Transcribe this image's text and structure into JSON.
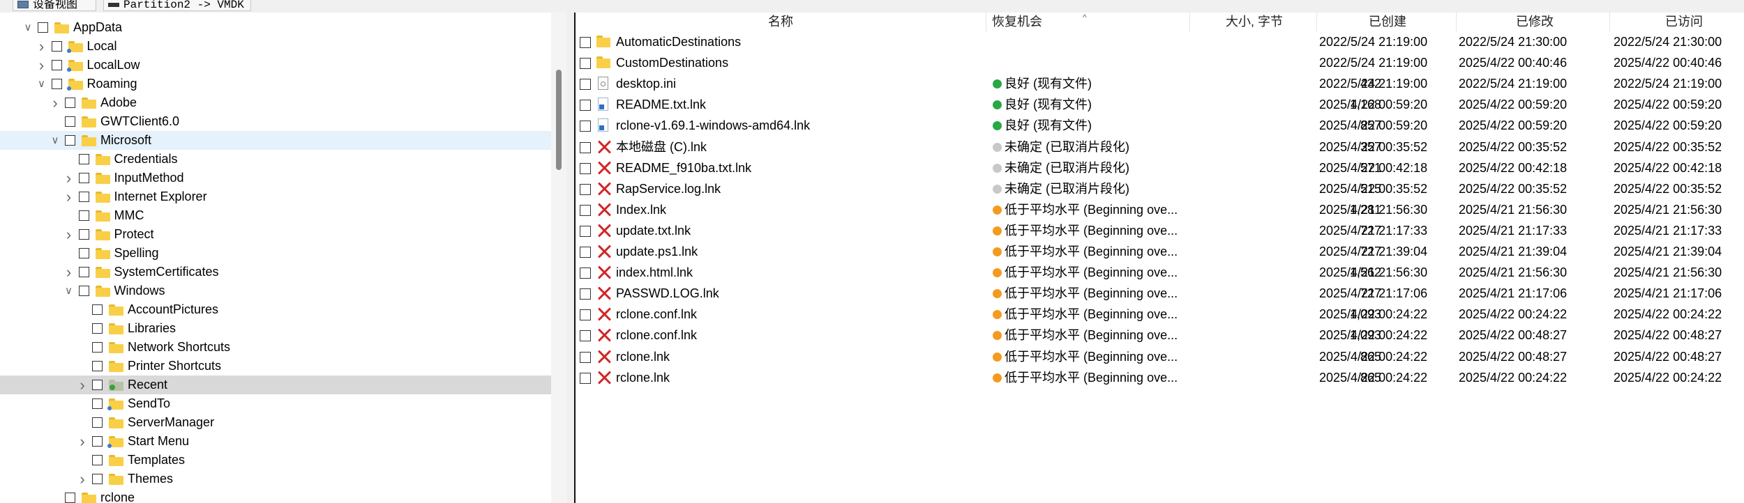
{
  "tabs": [
    {
      "label": "设备视图"
    },
    {
      "label": "Partition2 -> VMDK"
    }
  ],
  "tree": [
    {
      "label": "AppData",
      "indent": 4,
      "expander": "expanded",
      "folder": "yellow",
      "dot": false
    },
    {
      "label": "Local",
      "indent": 5,
      "expander": "collapsed",
      "folder": "yellow",
      "dot": true
    },
    {
      "label": "LocalLow",
      "indent": 5,
      "expander": "collapsed",
      "folder": "yellow",
      "dot": true
    },
    {
      "label": "Roaming",
      "indent": 5,
      "expander": "expanded",
      "folder": "yellow",
      "dot": true
    },
    {
      "label": "Adobe",
      "indent": 6,
      "expander": "collapsed",
      "folder": "yellow",
      "dot": false
    },
    {
      "label": "GWTClient6.0",
      "indent": 6,
      "expander": "none",
      "folder": "yellow",
      "dot": false
    },
    {
      "label": "Microsoft",
      "indent": 6,
      "expander": "expanded",
      "folder": "yellow",
      "dot": false,
      "state": "hover"
    },
    {
      "label": "Credentials",
      "indent": 7,
      "expander": "none",
      "folder": "yellow",
      "dot": false
    },
    {
      "label": "InputMethod",
      "indent": 7,
      "expander": "collapsed",
      "folder": "yellow",
      "dot": false
    },
    {
      "label": "Internet Explorer",
      "indent": 7,
      "expander": "collapsed",
      "folder": "yellow",
      "dot": false
    },
    {
      "label": "MMC",
      "indent": 7,
      "expander": "none",
      "folder": "yellow",
      "dot": false
    },
    {
      "label": "Protect",
      "indent": 7,
      "expander": "collapsed",
      "folder": "yellow",
      "dot": false
    },
    {
      "label": "Spelling",
      "indent": 7,
      "expander": "none",
      "folder": "yellow",
      "dot": false
    },
    {
      "label": "SystemCertificates",
      "indent": 7,
      "expander": "collapsed",
      "folder": "yellow",
      "dot": false
    },
    {
      "label": "Windows",
      "indent": 7,
      "expander": "expanded",
      "folder": "yellow",
      "dot": false
    },
    {
      "label": "AccountPictures",
      "indent": 8,
      "expander": "none",
      "folder": "yellow",
      "dot": false
    },
    {
      "label": "Libraries",
      "indent": 8,
      "expander": "none",
      "folder": "yellow",
      "dot": false
    },
    {
      "label": "Network Shortcuts",
      "indent": 8,
      "expander": "none",
      "folder": "yellow",
      "dot": false
    },
    {
      "label": "Printer Shortcuts",
      "indent": 8,
      "expander": "none",
      "folder": "yellow",
      "dot": false
    },
    {
      "label": "Recent",
      "indent": 8,
      "expander": "collapsed",
      "folder": "gray",
      "dot": false,
      "green": true,
      "state": "selected"
    },
    {
      "label": "SendTo",
      "indent": 8,
      "expander": "none",
      "folder": "yellow",
      "dot": true
    },
    {
      "label": "ServerManager",
      "indent": 8,
      "expander": "none",
      "folder": "yellow",
      "dot": false
    },
    {
      "label": "Start Menu",
      "indent": 8,
      "expander": "collapsed",
      "folder": "yellow",
      "dot": true
    },
    {
      "label": "Templates",
      "indent": 8,
      "expander": "none",
      "folder": "yellow",
      "dot": false
    },
    {
      "label": "Themes",
      "indent": 8,
      "expander": "collapsed",
      "folder": "yellow",
      "dot": false
    },
    {
      "label": "rclone",
      "indent": 6,
      "expander": "none",
      "folder": "yellow",
      "dot": false
    }
  ],
  "list": {
    "columns": {
      "name": "名称",
      "recovery": "恢复机会",
      "size": "大小, 字节",
      "created": "已创建",
      "modified": "已修改",
      "accessed": "已访问"
    },
    "sort_indicator": "^",
    "status_colors": {
      "good": "#27a844",
      "uncertain": "#c8c8c8",
      "below": "#f59a1f"
    },
    "rows": [
      {
        "icon": "folder",
        "name": "AutomaticDestinations",
        "status": "",
        "status_kind": "",
        "size": "",
        "created": "2022/5/24 21:19:00",
        "modified": "2022/5/24 21:30:00",
        "accessed": "2022/5/24 21:30:00"
      },
      {
        "icon": "folder",
        "name": "CustomDestinations",
        "status": "",
        "status_kind": "",
        "size": "",
        "created": "2022/5/24 21:19:00",
        "modified": "2025/4/22 00:40:46",
        "accessed": "2025/4/22 00:40:46"
      },
      {
        "icon": "doc",
        "name": "desktop.ini",
        "status": "良好 (现有文件)",
        "status_kind": "good",
        "size": "432",
        "created": "2022/5/24 21:19:00",
        "modified": "2022/5/24 21:19:00",
        "accessed": "2022/5/24 21:19:00"
      },
      {
        "icon": "lnk",
        "name": "README.txt.lnk",
        "status": "良好 (现有文件)",
        "status_kind": "good",
        "size": "1,168",
        "created": "2025/4/22 00:59:20",
        "modified": "2025/4/22 00:59:20",
        "accessed": "2025/4/22 00:59:20"
      },
      {
        "icon": "lnk",
        "name": "rclone-v1.69.1-windows-amd64.lnk",
        "status": "良好 (现有文件)",
        "status_kind": "good",
        "size": "857",
        "created": "2025/4/22 00:59:20",
        "modified": "2025/4/22 00:59:20",
        "accessed": "2025/4/22 00:59:20"
      },
      {
        "icon": "deleted",
        "name": "本地磁盘 (C).lnk",
        "status": "未确定 (已取消片段化)",
        "status_kind": "uncertain",
        "size": "357",
        "created": "2025/4/22 00:35:52",
        "modified": "2025/4/22 00:35:52",
        "accessed": "2025/4/22 00:35:52"
      },
      {
        "icon": "deleted",
        "name": "README_f910ba.txt.lnk",
        "status": "未确定 (已取消片段化)",
        "status_kind": "uncertain",
        "size": "571",
        "created": "2025/4/22 00:42:18",
        "modified": "2025/4/22 00:42:18",
        "accessed": "2025/4/22 00:42:18"
      },
      {
        "icon": "deleted",
        "name": "RapService.log.lnk",
        "status": "未确定 (已取消片段化)",
        "status_kind": "uncertain",
        "size": "515",
        "created": "2025/4/22 00:35:52",
        "modified": "2025/4/22 00:35:52",
        "accessed": "2025/4/22 00:35:52"
      },
      {
        "icon": "deleted",
        "name": "Index.lnk",
        "status": "低于平均水平 (Beginning ove...",
        "status_kind": "below",
        "size": "1,281",
        "created": "2025/4/21 21:56:30",
        "modified": "2025/4/21 21:56:30",
        "accessed": "2025/4/21 21:56:30"
      },
      {
        "icon": "deleted",
        "name": "update.txt.lnk",
        "status": "低于平均水平 (Beginning ove...",
        "status_kind": "below",
        "size": "727",
        "created": "2025/4/21 21:17:33",
        "modified": "2025/4/21 21:17:33",
        "accessed": "2025/4/21 21:17:33"
      },
      {
        "icon": "deleted",
        "name": "update.ps1.lnk",
        "status": "低于平均水平 (Beginning ove...",
        "status_kind": "below",
        "size": "727",
        "created": "2025/4/21 21:39:04",
        "modified": "2025/4/21 21:39:04",
        "accessed": "2025/4/21 21:39:04"
      },
      {
        "icon": "deleted",
        "name": "index.html.lnk",
        "status": "低于平均水平 (Beginning ove...",
        "status_kind": "below",
        "size": "1,562",
        "created": "2025/4/21 21:56:30",
        "modified": "2025/4/21 21:56:30",
        "accessed": "2025/4/21 21:56:30"
      },
      {
        "icon": "deleted",
        "name": "PASSWD.LOG.lnk",
        "status": "低于平均水平 (Beginning ove...",
        "status_kind": "below",
        "size": "727",
        "created": "2025/4/21 21:17:06",
        "modified": "2025/4/21 21:17:06",
        "accessed": "2025/4/21 21:17:06"
      },
      {
        "icon": "deleted",
        "name": "rclone.conf.lnk",
        "status": "低于平均水平 (Beginning ove...",
        "status_kind": "below",
        "size": "1,093",
        "created": "2025/4/22 00:24:22",
        "modified": "2025/4/22 00:24:22",
        "accessed": "2025/4/22 00:24:22"
      },
      {
        "icon": "deleted",
        "name": "rclone.conf.lnk",
        "status": "低于平均水平 (Beginning ove...",
        "status_kind": "below",
        "size": "1,093",
        "created": "2025/4/22 00:24:22",
        "modified": "2025/4/22 00:48:27",
        "accessed": "2025/4/22 00:48:27"
      },
      {
        "icon": "deleted",
        "name": "rclone.lnk",
        "status": "低于平均水平 (Beginning ove...",
        "status_kind": "below",
        "size": "865",
        "created": "2025/4/22 00:24:22",
        "modified": "2025/4/22 00:48:27",
        "accessed": "2025/4/22 00:48:27"
      },
      {
        "icon": "deleted",
        "name": "rclone.lnk",
        "status": "低于平均水平 (Beginning ove...",
        "status_kind": "below",
        "size": "865",
        "created": "2025/4/22 00:24:22",
        "modified": "2025/4/22 00:24:22",
        "accessed": "2025/4/22 00:24:22"
      }
    ]
  }
}
